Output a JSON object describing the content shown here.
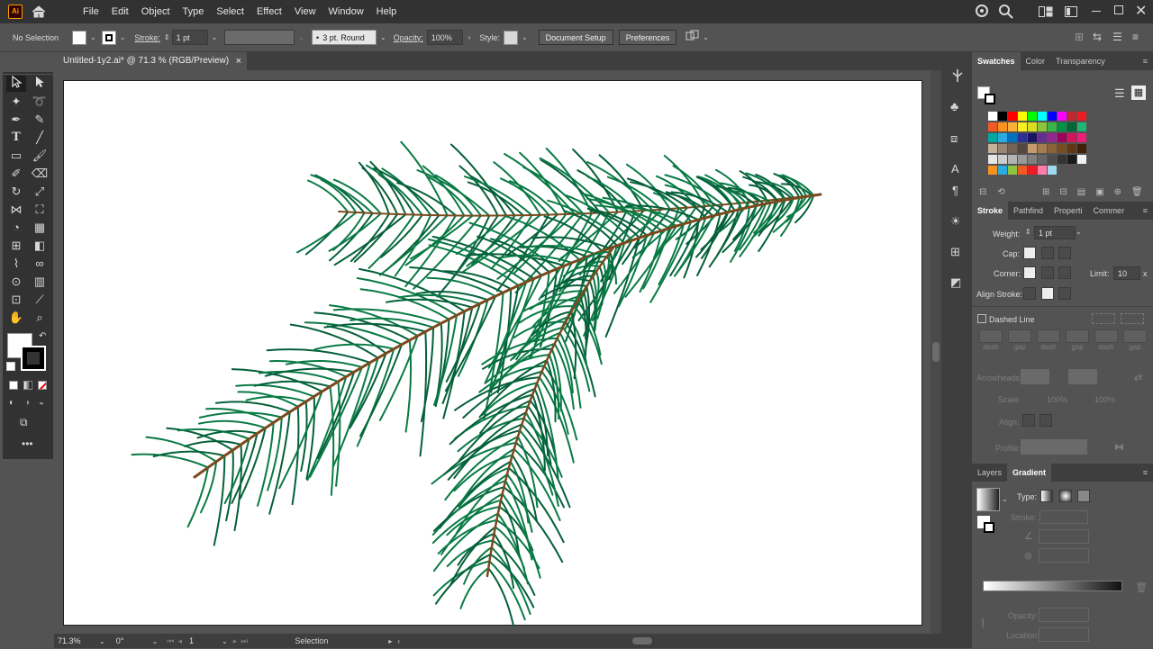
{
  "app": {
    "logo": "Ai"
  },
  "menu": [
    "File",
    "Edit",
    "Object",
    "Type",
    "Select",
    "Effect",
    "View",
    "Window",
    "Help"
  ],
  "control": {
    "selection": "No Selection",
    "stroke_label": "Stroke:",
    "stroke_weight": "1 pt",
    "brush": "3 pt. Round",
    "opacity_label": "Opacity:",
    "opacity": "100%",
    "style_label": "Style:",
    "document_setup": "Document Setup",
    "preferences": "Preferences"
  },
  "document": {
    "tab_title": "Untitled-1y2.ai* @ 71.3 % (RGB/Preview)",
    "close": "×"
  },
  "status": {
    "zoom": "71.3%",
    "rotation": "0°",
    "artboard": "1",
    "tool": "Selection"
  },
  "panels": {
    "swatches_tabs": [
      "Swatches",
      "Color",
      "Transparency"
    ],
    "stroke_tabs": [
      "Stroke",
      "Pathfind",
      "Properti",
      "Commer"
    ],
    "weight_label": "Weight:",
    "weight_value": "1 pt",
    "cap_label": "Cap:",
    "corner_label": "Corner:",
    "limit_label": "Limit:",
    "limit_value": "10",
    "limit_x": "x",
    "align_stroke_label": "Align Stroke:",
    "dashed_line": "Dashed Line",
    "dash_labels": [
      "dash",
      "gap",
      "dash",
      "gap",
      "dash",
      "gap"
    ],
    "arrowheads_label": "Arrowheads:",
    "scale_label": "Scale:",
    "scale_1": "100%",
    "scale_2": "100%",
    "align_label": "Align:",
    "profile_label": "Profile:",
    "gradient_tabs": [
      "Layers",
      "Gradient"
    ],
    "type_label": "Type:",
    "gstroke_label": "Stroke:",
    "g_opacity_label": "Opacity:",
    "g_location_label": "Location:"
  },
  "colors": {
    "needle": "#0a7a45",
    "needle_dark": "#05603a",
    "stem": "#7a4a1e",
    "ui_bg": "#535353"
  }
}
